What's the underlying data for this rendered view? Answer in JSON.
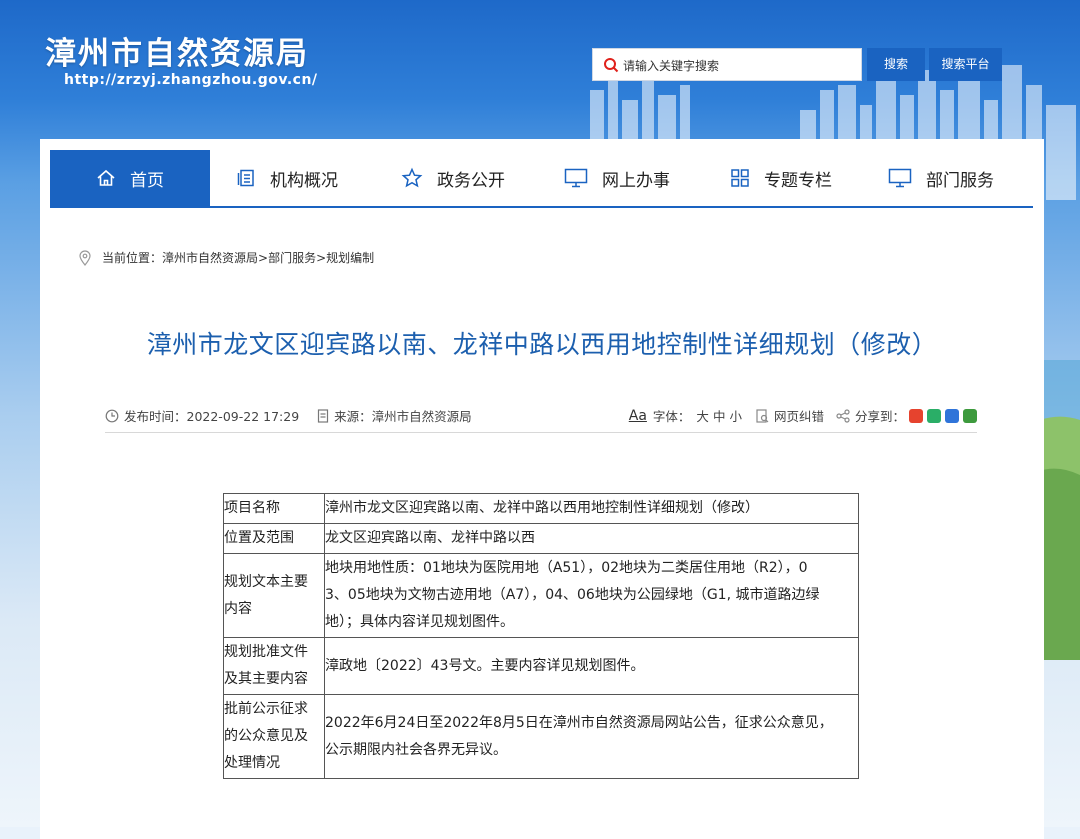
{
  "header": {
    "site_title": "漳州市自然资源局",
    "site_url": "http://zrzyj.zhangzhou.gov.cn/",
    "search_placeholder": "请输入关键字搜索",
    "search_button": "搜索",
    "search_platform_button": "搜索平台"
  },
  "nav": {
    "items": [
      {
        "label": "首页",
        "icon": "home-icon"
      },
      {
        "label": "机构概况",
        "icon": "document-list-icon"
      },
      {
        "label": "政务公开",
        "icon": "star-icon"
      },
      {
        "label": "网上办事",
        "icon": "monitor-icon"
      },
      {
        "label": "专题专栏",
        "icon": "grid-icon"
      },
      {
        "label": "部门服务",
        "icon": "monitor-icon"
      }
    ]
  },
  "breadcrumb": {
    "prefix": "当前位置：",
    "path": "漳州市自然资源局>部门服务>规划编制"
  },
  "article": {
    "title": "漳州市龙文区迎宾路以南、龙祥中路以西用地控制性详细规划（修改）",
    "publish_time": "发布时间：2022-09-22 17:29",
    "source": "来源：漳州市自然资源局",
    "font_size_label": "字体：",
    "font_sizes": [
      "大",
      "中",
      "小"
    ],
    "aa": "Aa",
    "report_error": "网页纠错",
    "share_label": "分享到："
  },
  "table": {
    "rows": [
      {
        "key": [
          "项目名称"
        ],
        "value": [
          "漳州市龙文区迎宾路以南、龙祥中路以西用地控制性详细规划（修改）"
        ]
      },
      {
        "key": [
          "位置及范围"
        ],
        "value": [
          "龙文区迎宾路以南、龙祥中路以西"
        ]
      },
      {
        "key": [
          "规划文本主要",
          "内容"
        ],
        "value": [
          "地块用地性质：01地块为医院用地（A51），02地块为二类居住用地（R2），0",
          "3、05地块为文物古迹用地（A7），04、06地块为公园绿地（G1, 城市道路边绿",
          "地）；具体内容详见规划图件。"
        ]
      },
      {
        "key": [
          "规划批准文件",
          "及其主要内容"
        ],
        "value": [
          "漳政地〔2022〕43号文。主要内容详见规划图件。"
        ]
      },
      {
        "key": [
          "批前公示征求",
          "的公众意见及",
          "处理情况"
        ],
        "value": [
          "2022年6月24日至2022年8月5日在漳州市自然资源局网站公告，征求公众意见，",
          "公示期限内社会各界无异议。"
        ]
      }
    ]
  },
  "colors": {
    "accent": "#1a63c1",
    "title_blue": "#1c5fae"
  }
}
